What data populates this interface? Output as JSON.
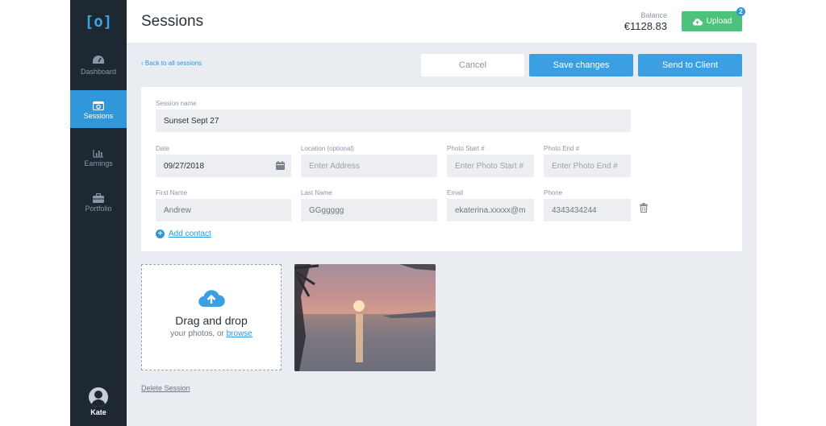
{
  "app": {
    "logo_text": "[o]",
    "colors": {
      "sidebar": "#1e2833",
      "accent": "#2f97da",
      "upload": "#4cc27a",
      "background": "#e9edf1"
    }
  },
  "sidebar": {
    "items": [
      {
        "label": "Dashboard",
        "icon": "dashboard-icon",
        "active": false
      },
      {
        "label": "Sessions",
        "icon": "sessions-icon",
        "active": true
      },
      {
        "label": "Earnings",
        "icon": "earnings-icon",
        "active": false
      },
      {
        "label": "Portfolio",
        "icon": "portfolio-icon",
        "active": false
      }
    ],
    "user": {
      "name": "Kate"
    }
  },
  "header": {
    "title": "Sessions",
    "balance_label": "Balance",
    "balance_value": "€1128.83",
    "upload_label": "Upload",
    "upload_badge": "2"
  },
  "toolbar": {
    "back_label": "Back to all sessions",
    "cancel_label": "Cancel",
    "save_label": "Save changes",
    "send_label": "Send to Client"
  },
  "form": {
    "session_name": {
      "label": "Session name",
      "value": "Sunset Sept 27"
    },
    "date": {
      "label": "Date",
      "value": "09/27/2018"
    },
    "location": {
      "label": "Location (optional)",
      "placeholder": "Enter Address"
    },
    "photo_start": {
      "label": "Photo Start #",
      "placeholder": "Enter Photo Start #"
    },
    "photo_end": {
      "label": "Photo End #",
      "placeholder": "Enter Photo End #"
    },
    "first_name": {
      "label": "First Name",
      "value": "Andrew"
    },
    "last_name": {
      "label": "Last Name",
      "value": "GGggggg"
    },
    "email": {
      "label": "Email",
      "value": "ekaterina.xxxxx@m"
    },
    "phone": {
      "label": "Phone",
      "value": "4343434244"
    },
    "add_contact_label": "Add contact"
  },
  "upload_area": {
    "title": "Drag and drop",
    "subtitle": "your photos, or",
    "browse_label": "browse"
  },
  "photo": {
    "alt": "sunset-photo"
  },
  "footer": {
    "delete_label": "Delete Session"
  }
}
